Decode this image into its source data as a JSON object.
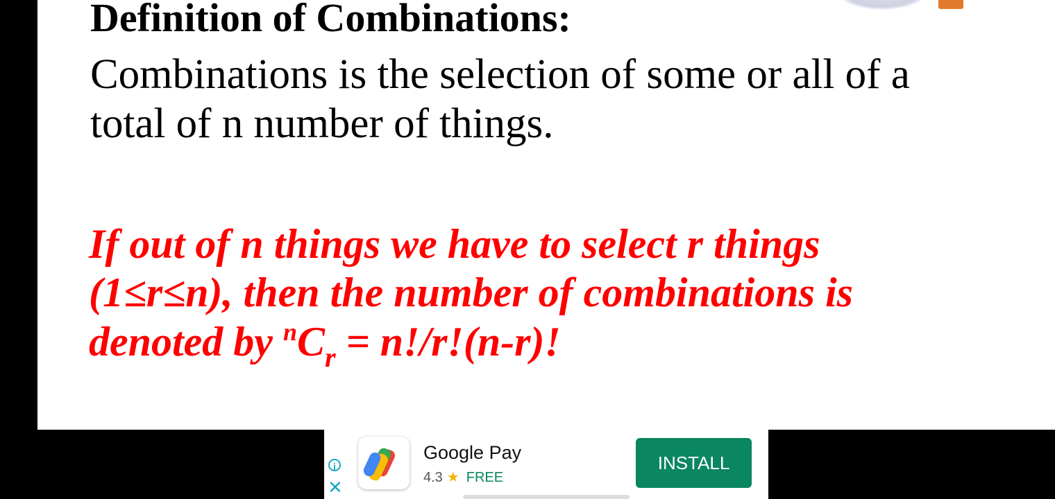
{
  "slide": {
    "title": "Definition of Combinations:",
    "body_lines": [
      "Combinations is the selection of some or all of a",
      "total of n number of things."
    ],
    "red_lines": [
      "If out of n things we have to select r things",
      "(1≤r≤n), then the number of combinations is"
    ],
    "formula": {
      "prefix": "denoted by ",
      "sup": "n",
      "base": "C",
      "sub": "r",
      "rhs": " =  n!/r!(n-r)!"
    }
  },
  "ad": {
    "app_name": "Google Pay",
    "rating": "4.3",
    "star": "★",
    "price": "FREE",
    "install_label": "INSTALL",
    "info_icon": "i",
    "close_icon": "✕"
  }
}
